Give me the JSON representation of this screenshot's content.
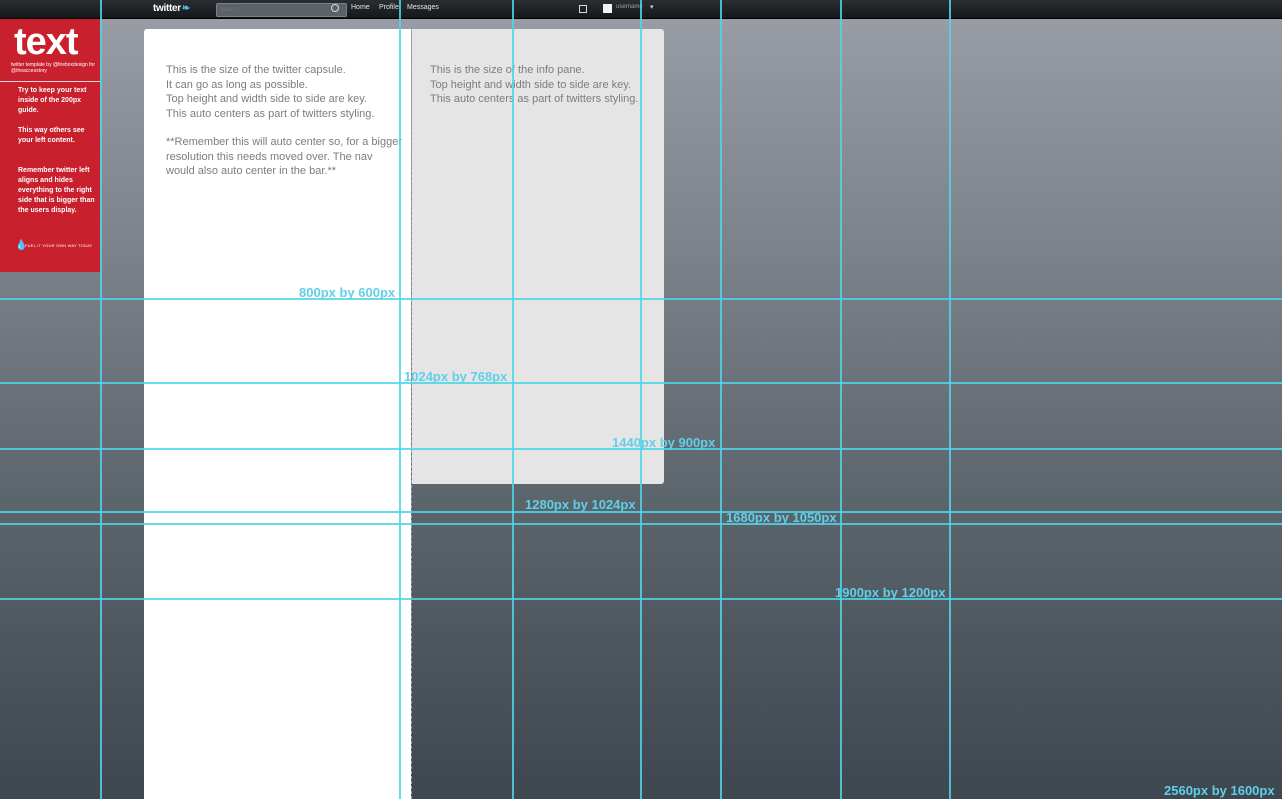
{
  "topbar": {
    "logo": "twitter",
    "search_placeholder": "Search",
    "nav": [
      "Home",
      "Profile",
      "Messages"
    ],
    "username": "username",
    "icons": [
      "search-icon",
      "compose-icon",
      "chevron-down-icon",
      "bird-icon"
    ]
  },
  "sidebar": {
    "title": "text",
    "subtitle": "twitter template by @fireboxdesign for @theaccesstory",
    "paragraphs": [
      "Try to keep your text inside of the 200px guide.",
      "This way others see your left content.",
      "Remember twitter left aligns and hides everything to the right side that is bigger than the users display."
    ],
    "footer": "FUEL IT YOUR OWN WAY TODAY"
  },
  "capsule": {
    "lines": [
      "This is the size of the twitter capsule.",
      "It can go as long as possible.",
      "Top height and width side to side are key.",
      "This auto centers as part of twitters styling."
    ],
    "note": [
      "**Remember this will auto center so, for a bigger",
      "resolution this needs moved over. The nav",
      "would also auto center in the bar.**"
    ]
  },
  "info_pane": {
    "lines": [
      "This is the size of the info pane.",
      "Top height and width side to side are key.",
      "This auto centers as part of twitters styling."
    ]
  },
  "guides": {
    "labels": [
      "800px by 600px",
      "1024px by 768px",
      "1440px by 900px",
      "1280px by 1024px",
      "1680px by 1050px",
      "1900px by 1200px",
      "2560px by 1600px"
    ]
  },
  "colors": {
    "sidebar_red": "#c8202d",
    "guide_cyan": "#4fd6e8",
    "bird_blue": "#5ab7e6"
  }
}
